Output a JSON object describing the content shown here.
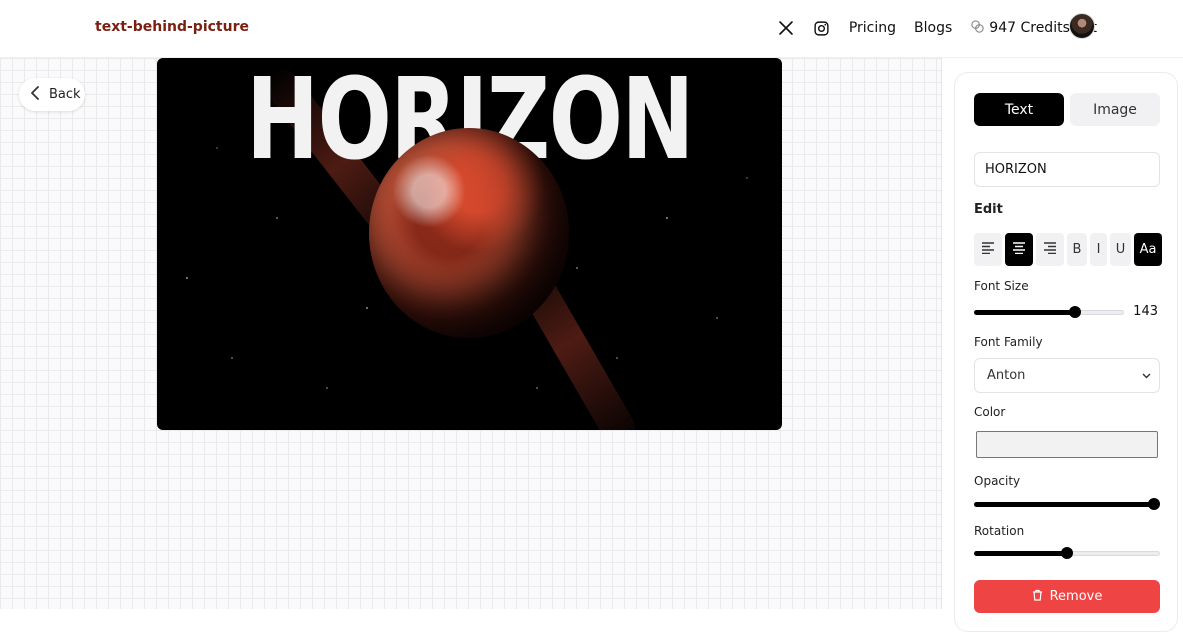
{
  "header": {
    "brand": "text-behind-picture",
    "nav": {
      "x_icon": "x-logo-icon",
      "instagram_icon": "instagram-icon",
      "pricing": "Pricing",
      "blogs": "Blogs",
      "credits": "947 Credits left"
    }
  },
  "canvas": {
    "back_label": "Back",
    "overlay_text": "HORIZON"
  },
  "panel": {
    "tabs": {
      "text": "Text",
      "image": "Image"
    },
    "text_value": "HORIZON",
    "edit_label": "Edit",
    "tools": {
      "bold": "B",
      "italic": "I",
      "underline": "U",
      "case": "Aa"
    },
    "font_size": {
      "label": "Font Size",
      "value": "143",
      "fraction": 0.69
    },
    "font_family": {
      "label": "Font Family",
      "value": "Anton"
    },
    "color": {
      "label": "Color",
      "value": "#f2f2f2"
    },
    "opacity": {
      "label": "Opacity",
      "fraction": 1.0
    },
    "rotation": {
      "label": "Rotation",
      "fraction": 0.5
    },
    "remove_label": "Remove"
  },
  "colors": {
    "brand": "#7a1f12",
    "active": "#000000",
    "danger": "#ef4444"
  }
}
